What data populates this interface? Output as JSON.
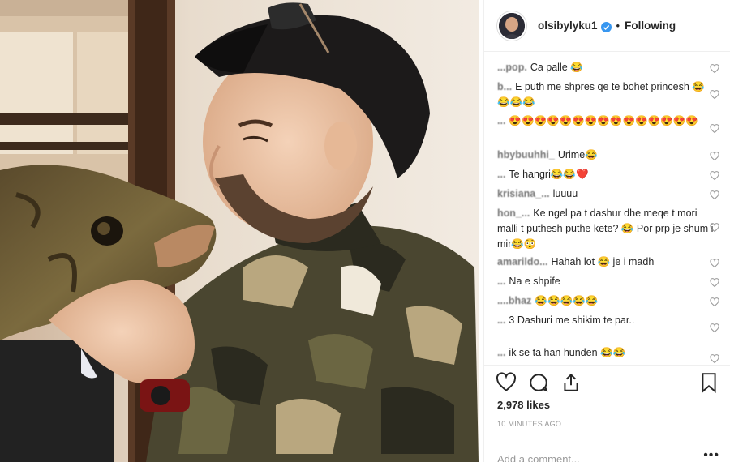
{
  "post": {
    "username": "olsibylyku1",
    "separator": "•",
    "follow_status": "Following",
    "likes": "2,978 likes",
    "time": "10 MINUTES AGO",
    "add_comment_placeholder": "Add a comment...",
    "more": "•••"
  },
  "comments": [
    {
      "user": "...pop.",
      "text": "Ca palle 😂"
    },
    {
      "user": "b...",
      "text": "E puth me shpres qe te bohet princesh 😂😂😂😂"
    },
    {
      "user": "...",
      "text": "😍😍😍😍😍😍😍😍😍😍😍😍😍😍😍"
    },
    {
      "user": "hbybuuhhi_",
      "text": "Urime😂"
    },
    {
      "user": "...",
      "text": "Te hangri😂😂❤️"
    },
    {
      "user": "krisiana_...",
      "text": "luuuu"
    },
    {
      "user": "hon_...",
      "text": "Ke ngel pa t dashur dhe meqe t mori malli t puthesh puthe kete? 😂 Por prp je shum i mir😂😳"
    },
    {
      "user": "amarildo...",
      "text": "Hahah lot 😂 je i madh"
    },
    {
      "user": "...",
      "text": "Na e shpife"
    },
    {
      "user": "....bhaz",
      "text": "😂😂😂😂😂"
    },
    {
      "user": "...",
      "text": "3 Dashuri me shikim te par.."
    },
    {
      "user": "...",
      "text": "ik se ta han hunden 😂😂"
    }
  ],
  "colors": {
    "verified": "#3897f0",
    "text": "#262626",
    "muted": "#999999",
    "camo_dark": "#3a3a2a",
    "camo_olive": "#6b6642",
    "camo_tan": "#b9a77f"
  },
  "icons": [
    "heart-icon",
    "comment-icon",
    "share-icon",
    "bookmark-icon",
    "verified-badge-icon"
  ]
}
